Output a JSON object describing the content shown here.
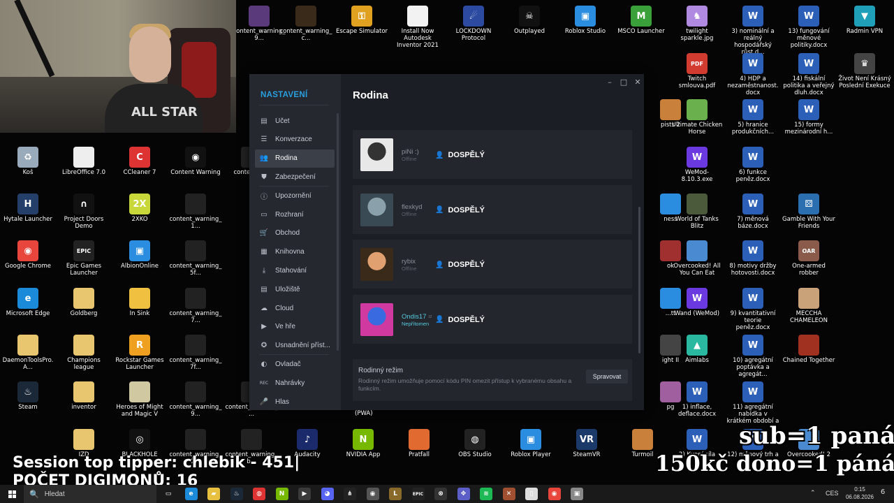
{
  "desktop": {
    "icons": [
      {
        "label": "content_warning_9...",
        "color": "#5a3a7a",
        "glyph": ""
      },
      {
        "label": "content_warning_c...",
        "color": "#3a2a1a",
        "glyph": ""
      },
      {
        "label": "Escape Simulator",
        "color": "#e0a020",
        "glyph": "⚿"
      },
      {
        "label": "Install Now Autodesk Inventor 2021",
        "color": "#f2f2f2",
        "glyph": ""
      },
      {
        "label": "LOCKDOWN Protocol",
        "color": "#2b4aa0",
        "glyph": "☄"
      },
      {
        "label": "Outplayed",
        "color": "#111",
        "glyph": "☠"
      },
      {
        "label": "Roblox Studio",
        "color": "#2a8de0",
        "glyph": "▣"
      },
      {
        "label": "MSCO Launcher",
        "color": "#3aa03a",
        "glyph": "M"
      },
      {
        "label": "twilight sparkle.jpg",
        "color": "#b08ae0",
        "glyph": "♞"
      },
      {
        "label": "3) nominální a reálný hospodářský růst.d...",
        "color": "#2b5fb8",
        "glyph": "W"
      },
      {
        "label": "13) fungování měnové politiky.docx",
        "color": "#2b5fb8",
        "glyph": "W"
      },
      {
        "label": "Radmin VPN",
        "color": "#1fa0b8",
        "glyph": "▼"
      },
      {
        "label": "Twitch smlouva.pdf",
        "color": "#d23b2f",
        "glyph": "PDF"
      },
      {
        "label": "4) HDP a nezaměstnanost.docx",
        "color": "#2b5fb8",
        "glyph": "W"
      },
      {
        "label": "14) fiskální politika a veřejný dluh.docx",
        "color": "#2b5fb8",
        "glyph": "W"
      },
      {
        "label": "Život Není Krásný Poslední Exekuce",
        "color": "#444",
        "glyph": "♛"
      },
      {
        "label": "Koš",
        "color": "#9ab",
        "glyph": "♻"
      },
      {
        "label": "LibreOffice 7.0",
        "color": "#eee",
        "glyph": ""
      },
      {
        "label": "CCleaner 7",
        "color": "#d33",
        "glyph": "C"
      },
      {
        "label": "Content Warning",
        "color": "#111",
        "glyph": "◉"
      },
      {
        "label": "Ultimate Chicken Horse",
        "color": "#6ab04c",
        "glyph": ""
      },
      {
        "label": "5) hranice produkčních...",
        "color": "#2b5fb8",
        "glyph": "W"
      },
      {
        "label": "15) formy mezinárodní h...",
        "color": "#2b5fb8",
        "glyph": "W"
      },
      {
        "label": "WeMod-8.10.3.exe",
        "color": "#6a3ae0",
        "glyph": "W"
      },
      {
        "label": "6) funkce peněz.docx",
        "color": "#2b5fb8",
        "glyph": "W"
      },
      {
        "label": "Hytale Launcher",
        "color": "#24406a",
        "glyph": "H"
      },
      {
        "label": "Project Doors Demo",
        "color": "#111",
        "glyph": "∩"
      },
      {
        "label": "2XKO",
        "color": "#c8d83a",
        "glyph": "2X"
      },
      {
        "label": "content_warning_1...",
        "color": "#222",
        "glyph": ""
      },
      {
        "label": "World of Tanks Blitz",
        "color": "#4a5a3a",
        "glyph": ""
      },
      {
        "label": "7) měnová báze.docx",
        "color": "#2b5fb8",
        "glyph": "W"
      },
      {
        "label": "Gamble With Your Friends",
        "color": "#2c6fb0",
        "glyph": "⚄"
      },
      {
        "label": "Google Chrome",
        "color": "#e8453c",
        "glyph": "◉"
      },
      {
        "label": "Epic Games Launcher",
        "color": "#222",
        "glyph": "EPIC"
      },
      {
        "label": "AlbionOnline",
        "color": "#2a8de0",
        "glyph": "▣"
      },
      {
        "label": "content_warning_5f...",
        "color": "#222",
        "glyph": ""
      },
      {
        "label": "Overcooked! All You Can Eat",
        "color": "#4a8ad0",
        "glyph": ""
      },
      {
        "label": "8) motivy držby hotovosti.docx",
        "color": "#2b5fb8",
        "glyph": "W"
      },
      {
        "label": "One-armed robber",
        "color": "#8a5a4a",
        "glyph": "OAR"
      },
      {
        "label": "Microsoft Edge",
        "color": "#1b8ad8",
        "glyph": "e"
      },
      {
        "label": "Goldberg",
        "color": "#e8c670",
        "glyph": ""
      },
      {
        "label": "In Sink",
        "color": "#f0c040",
        "glyph": ""
      },
      {
        "label": "content_warning_7...",
        "color": "#222",
        "glyph": ""
      },
      {
        "label": "Wand (WeMod)",
        "color": "#6a3ae0",
        "glyph": "W"
      },
      {
        "label": "9) kvantitativní teorie peněz.docx",
        "color": "#2b5fb8",
        "glyph": "W"
      },
      {
        "label": "MECCHA CHAMELEON",
        "color": "#c9a27a",
        "glyph": ""
      },
      {
        "label": "DaemonToolsPro.A...",
        "color": "#e8c670",
        "glyph": ""
      },
      {
        "label": "Champions league",
        "color": "#e8c670",
        "glyph": ""
      },
      {
        "label": "Rockstar Games Launcher",
        "color": "#f0a020",
        "glyph": "R"
      },
      {
        "label": "content_warning_7f...",
        "color": "#222",
        "glyph": ""
      },
      {
        "label": "Aimlabs",
        "color": "#2ab8a0",
        "glyph": "▲"
      },
      {
        "label": "10) agregátní poptávka a agregát...",
        "color": "#2b5fb8",
        "glyph": "W"
      },
      {
        "label": "Chained Together",
        "color": "#a03020",
        "glyph": ""
      },
      {
        "label": "Steam",
        "color": "#1b2838",
        "glyph": "♨"
      },
      {
        "label": "inventor",
        "color": "#e8c670",
        "glyph": ""
      },
      {
        "label": "Heroes of Might and Magic V",
        "color": "#d0c8a0",
        "glyph": ""
      },
      {
        "label": "content_warning_9...",
        "color": "#222",
        "glyph": ""
      },
      {
        "label": "1) inflace, deflace.docx",
        "color": "#2b5fb8",
        "glyph": "W"
      },
      {
        "label": "11) agregátní nabídka v krátkém období a ...",
        "color": "#2b5fb8",
        "glyph": "W"
      },
      {
        "label": "IZD",
        "color": "#e8c670",
        "glyph": ""
      },
      {
        "label": "BLACKHOLE",
        "color": "#111",
        "glyph": "◎"
      },
      {
        "label": "content_warning_2...",
        "color": "#222",
        "glyph": ""
      },
      {
        "label": "content_warning_b...",
        "color": "#222",
        "glyph": ""
      },
      {
        "label": "Audacity",
        "color": "#1a2a6a",
        "glyph": "♪"
      },
      {
        "label": "NVIDIA App",
        "color": "#76b900",
        "glyph": "N"
      },
      {
        "label": "Pratfall",
        "color": "#e06a30",
        "glyph": ""
      },
      {
        "label": "OBS Studio",
        "color": "#222",
        "glyph": "◍"
      },
      {
        "label": "Roblox Player",
        "color": "#2a8de0",
        "glyph": "▣"
      },
      {
        "label": "SteamVR",
        "color": "#1b3a6a",
        "glyph": "VR"
      },
      {
        "label": "Turmoil",
        "color": "#c8803a",
        "glyph": ""
      },
      {
        "label": "2) Kupní síla",
        "color": "#2b5fb8",
        "glyph": "W"
      },
      {
        "label": "12) měnový trh a",
        "color": "#2b5fb8",
        "glyph": "W"
      },
      {
        "label": "Overcooked! 2",
        "color": "#4a8ad0",
        "glyph": ""
      },
      {
        "label": "content_warning_...",
        "color": "#222",
        "glyph": ""
      },
      {
        "label": "content_w...",
        "color": "#222",
        "glyph": ""
      },
      {
        "label": "ness",
        "color": "#2a8de0",
        "glyph": ""
      },
      {
        "label": "pists 2",
        "color": "#c8803a",
        "glyph": ""
      },
      {
        "label": "ok",
        "color": "#a03030",
        "glyph": ""
      },
      {
        "label": "...tt",
        "color": "#2a8de0",
        "glyph": ""
      },
      {
        "label": "ight II",
        "color": "#444",
        "glyph": ""
      },
      {
        "label": "pg",
        "color": "#a060a0",
        "glyph": ""
      }
    ]
  },
  "webcam": {
    "shirt_text": "ALL STAR"
  },
  "steam_settings": {
    "sidebar_title": "NASTAVENÍ",
    "page_title": "Rodina",
    "window_controls": {
      "minimize": "–",
      "maximize": "□",
      "close": "✕"
    },
    "sidebar_items": [
      {
        "label": "Účet",
        "icon": "▤"
      },
      {
        "label": "Konverzace",
        "icon": "☰"
      },
      {
        "label": "Rodina",
        "icon": "👥",
        "active": true
      },
      {
        "label": "Zabezpečení",
        "icon": "⛊"
      },
      {
        "label": "Upozornění",
        "icon": "ⓘ"
      },
      {
        "label": "Rozhraní",
        "icon": "▭"
      },
      {
        "label": "Obchod",
        "icon": "🛒"
      },
      {
        "label": "Knihovna",
        "icon": "▦"
      },
      {
        "label": "Stahování",
        "icon": "⤓"
      },
      {
        "label": "Úložiště",
        "icon": "▤"
      },
      {
        "label": "Cloud",
        "icon": "☁"
      },
      {
        "label": "Ve hře",
        "icon": "▶"
      },
      {
        "label": "Usnadnění příst...",
        "icon": "✪"
      },
      {
        "label": "Ovladač",
        "icon": "◐"
      },
      {
        "label": "Nahrávky",
        "icon": "REC"
      },
      {
        "label": "Hlas",
        "icon": "🎤"
      }
    ],
    "members": [
      {
        "name": "piNi :)",
        "status": "Offline",
        "role": "DOSPĚLÝ",
        "role_icon": "👤",
        "avatar_colors": [
          "#e8e8e8",
          "#333"
        ],
        "online": false
      },
      {
        "name": "flexkyd",
        "status": "Offline",
        "role": "DOSPĚLÝ",
        "role_icon": "👤",
        "avatar_colors": [
          "#3a4a55",
          "#8aa0aa"
        ],
        "online": false
      },
      {
        "name": "rybix",
        "status": "Offline",
        "role": "DOSPĚLÝ",
        "role_icon": "👤",
        "avatar_colors": [
          "#3a2a1a",
          "#e0a070"
        ],
        "online": false
      },
      {
        "name": "Ondis17",
        "name_suffix": "ᶻᶻ",
        "status": "Nepřítomen",
        "role": "DOSPĚLÝ",
        "role_icon": "👤",
        "avatar_colors": [
          "#d03aa0",
          "#3a6ae0"
        ],
        "online": true
      }
    ],
    "family_mode": {
      "title": "Rodinný režim",
      "description": "Rodinný režim umožňuje pomocí kódu PIN omezit přístup k vybranému obsahu a funkcím.",
      "button": "Spravovat"
    }
  },
  "pwa_label": "(PWA)",
  "overlays": {
    "tipper": "Session top tipper: chlebik - 451|",
    "digimon": "POČET DIGIMONŮ: 16",
    "sub": "sub=1 panák",
    "dono": "150kč dono=1 pánák"
  },
  "taskbar": {
    "search_placeholder": "Hledat",
    "search_icon": "🔍",
    "apps": [
      {
        "name": "task-view",
        "glyph": "▭",
        "color": "#1a1a1a"
      },
      {
        "name": "edge",
        "glyph": "e",
        "color": "#1b8ad8"
      },
      {
        "name": "explorer",
        "glyph": "▰",
        "color": "#e8c040"
      },
      {
        "name": "steam",
        "glyph": "♨",
        "color": "#1b2838"
      },
      {
        "name": "cc",
        "glyph": "◍",
        "color": "#d33"
      },
      {
        "name": "nvidia",
        "glyph": "N",
        "color": "#76b900"
      },
      {
        "name": "media",
        "glyph": "▶",
        "color": "#3a3a3a"
      },
      {
        "name": "discord",
        "glyph": "◕",
        "color": "#5865f2"
      },
      {
        "name": "razer",
        "glyph": "⋔",
        "color": "#222"
      },
      {
        "name": "chrome-alt",
        "glyph": "◉",
        "color": "#555"
      },
      {
        "name": "lol",
        "glyph": "L",
        "color": "#8a6a2a"
      },
      {
        "name": "epic",
        "glyph": "EPIC",
        "color": "#222"
      },
      {
        "name": "steam2",
        "glyph": "⊗",
        "color": "#333"
      },
      {
        "name": "teams",
        "glyph": "✥",
        "color": "#5b5fc7"
      },
      {
        "name": "spotify",
        "glyph": "≋",
        "color": "#1db954"
      },
      {
        "name": "game",
        "glyph": "✕",
        "color": "#a05030"
      },
      {
        "name": "file",
        "glyph": "▯",
        "color": "#ddd"
      },
      {
        "name": "chrome",
        "glyph": "◉",
        "color": "#e8453c"
      },
      {
        "name": "window",
        "glyph": "▣",
        "color": "#888"
      }
    ],
    "tray": {
      "chevron": "⌃",
      "language": "CES",
      "time": "0:15",
      "date": "06.08.2026",
      "notifications": "6"
    }
  }
}
